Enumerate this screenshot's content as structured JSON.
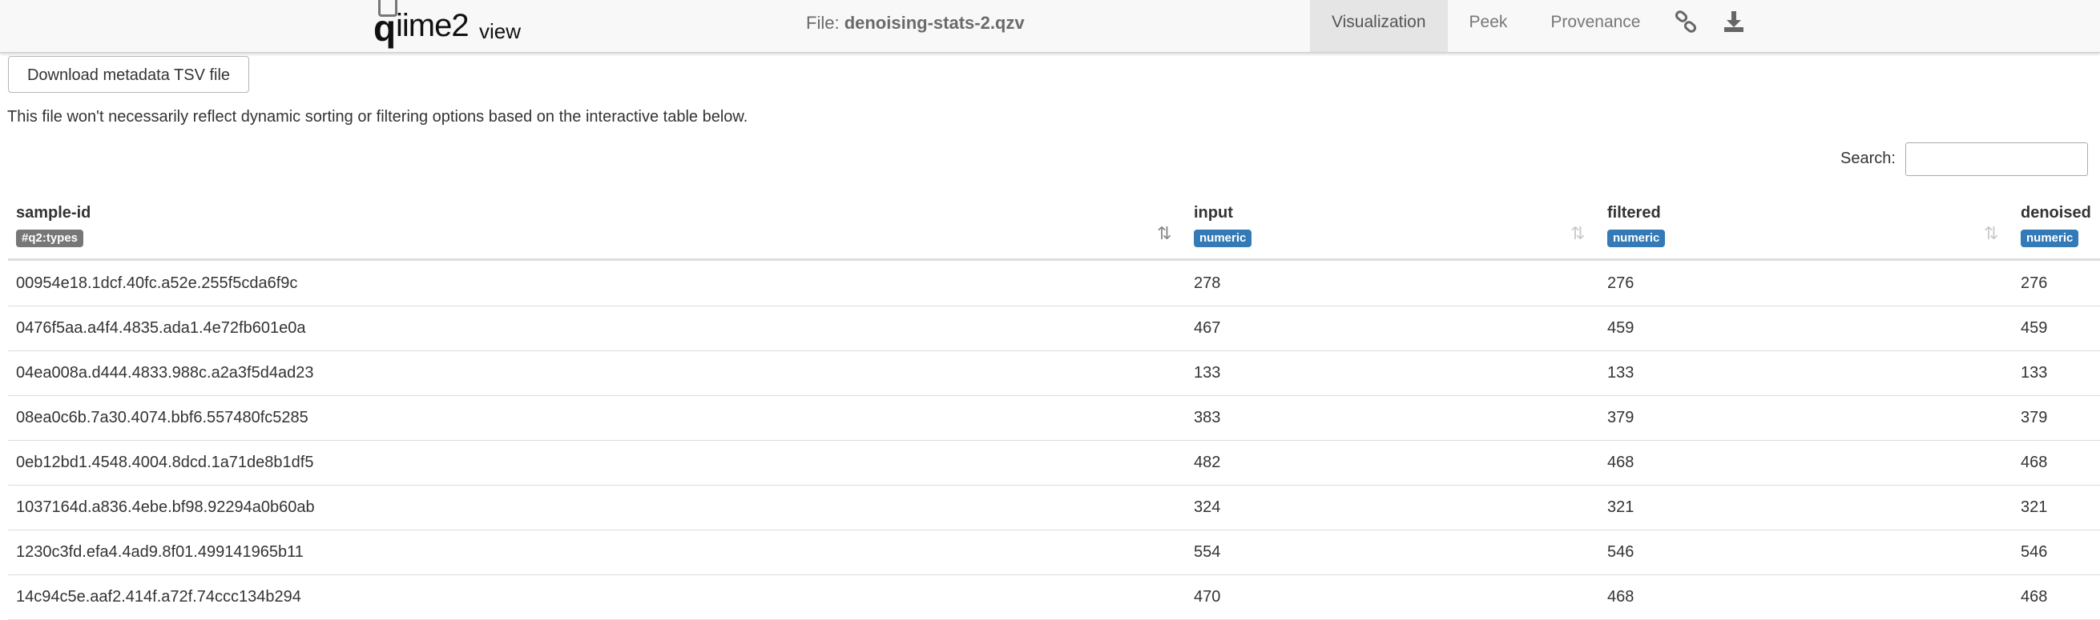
{
  "header": {
    "logo_text": "qiime2view",
    "file_label": "File:",
    "file_name": "denoising-stats-2.qzv",
    "tabs": [
      {
        "label": "Visualization",
        "active": true
      },
      {
        "label": "Peek",
        "active": false
      },
      {
        "label": "Provenance",
        "active": false
      }
    ],
    "icons": [
      "link-icon",
      "download-icon"
    ]
  },
  "toolbar": {
    "download_label": "Download metadata TSV file",
    "note": "This file won't necessarily reflect dynamic sorting or filtering options based on the interactive table below.",
    "search_label": "Search:",
    "search_value": ""
  },
  "table": {
    "columns": [
      {
        "name": "sample-id",
        "badge": "#q2:types",
        "badge_color": "#777777",
        "sorted": true
      },
      {
        "name": "input",
        "badge": "numeric",
        "badge_color": "#337ab7",
        "sorted": false
      },
      {
        "name": "filtered",
        "badge": "numeric",
        "badge_color": "#337ab7",
        "sorted": false
      },
      {
        "name": "denoised",
        "badge": "numeric",
        "badge_color": "#337ab7",
        "sorted": false
      }
    ],
    "rows": [
      [
        "00954e18.1dcf.40fc.a52e.255f5cda6f9c",
        "278",
        "276",
        "276"
      ],
      [
        "0476f5aa.a4f4.4835.ada1.4e72fb601e0a",
        "467",
        "459",
        "459"
      ],
      [
        "04ea008a.d444.4833.988c.a2a3f5d4ad23",
        "133",
        "133",
        "133"
      ],
      [
        "08ea0c6b.7a30.4074.bbf6.557480fc5285",
        "383",
        "379",
        "379"
      ],
      [
        "0eb12bd1.4548.4004.8dcd.1a71de8b1df5",
        "482",
        "468",
        "468"
      ],
      [
        "1037164d.a836.4ebe.bf98.92294a0b60ab",
        "324",
        "321",
        "321"
      ],
      [
        "1230c3fd.efa4.4ad9.8f01.499141965b11",
        "554",
        "546",
        "546"
      ],
      [
        "14c94c5e.aaf2.414f.a72f.74ccc134b294",
        "470",
        "468",
        "468"
      ]
    ]
  }
}
